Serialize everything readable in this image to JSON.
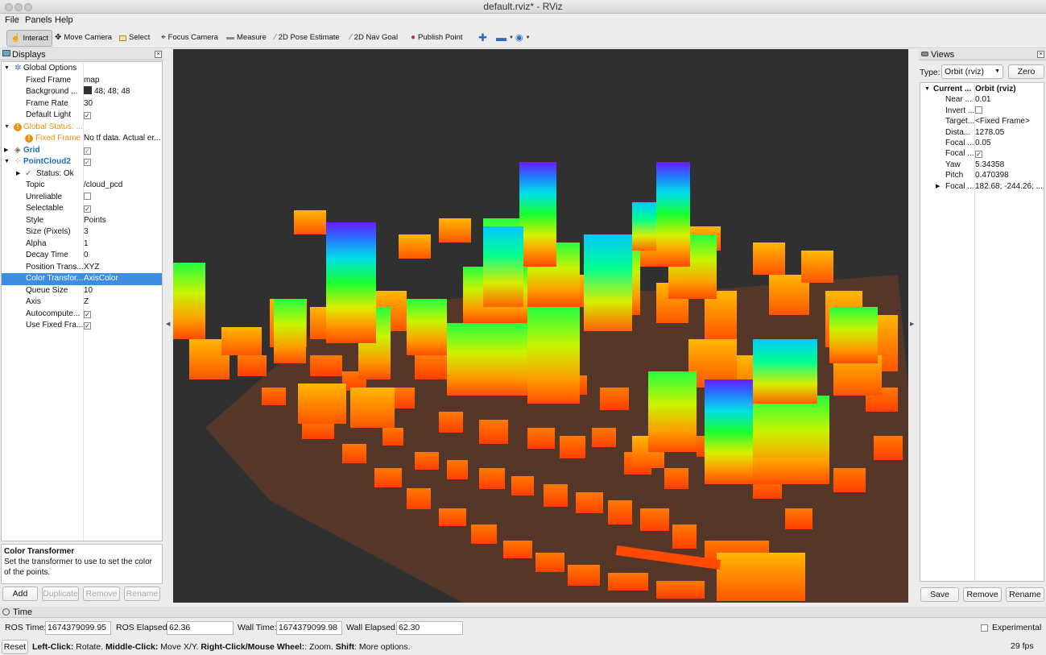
{
  "window": {
    "title": "default.rviz* - RViz"
  },
  "menu": [
    "File",
    "Panels",
    "Help"
  ],
  "toolbar": {
    "tools": [
      "Interact",
      "Move Camera",
      "Select",
      "Focus Camera",
      "Measure",
      "2D Pose Estimate",
      "2D Nav Goal",
      "Publish Point"
    ]
  },
  "displays": {
    "title": "Displays",
    "rows": [
      {
        "k": "Global Options",
        "v": ""
      },
      {
        "k": "Fixed Frame",
        "v": "map"
      },
      {
        "k": "Background ...",
        "v": "48; 48; 48"
      },
      {
        "k": "Frame Rate",
        "v": "30"
      },
      {
        "k": "Default Light",
        "v": ""
      },
      {
        "k": "Global Status: ...",
        "v": ""
      },
      {
        "k": "Fixed Frame",
        "v": "No tf data.  Actual er..."
      },
      {
        "k": "Grid",
        "v": ""
      },
      {
        "k": "PointCloud2",
        "v": ""
      },
      {
        "k": "Status: Ok",
        "v": ""
      },
      {
        "k": "Topic",
        "v": "/cloud_pcd"
      },
      {
        "k": "Unreliable",
        "v": ""
      },
      {
        "k": "Selectable",
        "v": ""
      },
      {
        "k": "Style",
        "v": "Points"
      },
      {
        "k": "Size (Pixels)",
        "v": "3"
      },
      {
        "k": "Alpha",
        "v": "1"
      },
      {
        "k": "Decay Time",
        "v": "0"
      },
      {
        "k": "Position Trans...",
        "v": "XYZ"
      },
      {
        "k": "Color Transfor...",
        "v": "AxisColor"
      },
      {
        "k": "Queue Size",
        "v": "10"
      },
      {
        "k": "Axis",
        "v": "Z"
      },
      {
        "k": "Autocompute...",
        "v": ""
      },
      {
        "k": "Use Fixed Fra...",
        "v": ""
      }
    ],
    "desc_title": "Color Transformer",
    "desc_text": "Set the transformer to use to set the color of the points.",
    "buttons": [
      "Add",
      "Duplicate",
      "Remove",
      "Rename"
    ]
  },
  "views": {
    "title": "Views",
    "type_label": "Type:",
    "type_value": "Orbit (rviz)",
    "zero": "Zero",
    "rows": [
      {
        "k": "Current ...",
        "v": "Orbit (rviz)"
      },
      {
        "k": "Near ...",
        "v": "0.01"
      },
      {
        "k": "Invert ...",
        "v": ""
      },
      {
        "k": "Target...",
        "v": "<Fixed Frame>"
      },
      {
        "k": "Dista...",
        "v": "1278.05"
      },
      {
        "k": "Focal ...",
        "v": "0.05"
      },
      {
        "k": "Focal ...",
        "v": ""
      },
      {
        "k": "Yaw",
        "v": "5.34358"
      },
      {
        "k": "Pitch",
        "v": "0.470398"
      },
      {
        "k": "Focal ...",
        "v": "182.68; -244.26; ..."
      }
    ],
    "buttons": [
      "Save",
      "Remove",
      "Rename"
    ]
  },
  "time": {
    "title": "Time",
    "ros_time_label": "ROS Time:",
    "ros_time": "1674379099.95",
    "ros_elapsed_label": "ROS Elapsed:",
    "ros_elapsed": "62.36",
    "wall_time_label": "Wall Time:",
    "wall_time": "1674379099.98",
    "wall_elapsed_label": "Wall Elapsed:",
    "wall_elapsed": "62.30",
    "experimental": "Experimental"
  },
  "status": {
    "reset": "Reset",
    "hint_b1": "Left-Click:",
    "hint_t1": " Rotate. ",
    "hint_b2": "Middle-Click:",
    "hint_t2": " Move X/Y. ",
    "hint_b3": "Right-Click/Mouse Wheel:",
    "hint_t3": ": Zoom. ",
    "hint_b4": "Shift",
    "hint_t4": ": More options.",
    "fps": "29 fps"
  },
  "colors": {
    "background": "#303030",
    "selection": "#3d8ee0",
    "accent_link": "#1a6fc4",
    "warn": "#e8920f"
  }
}
